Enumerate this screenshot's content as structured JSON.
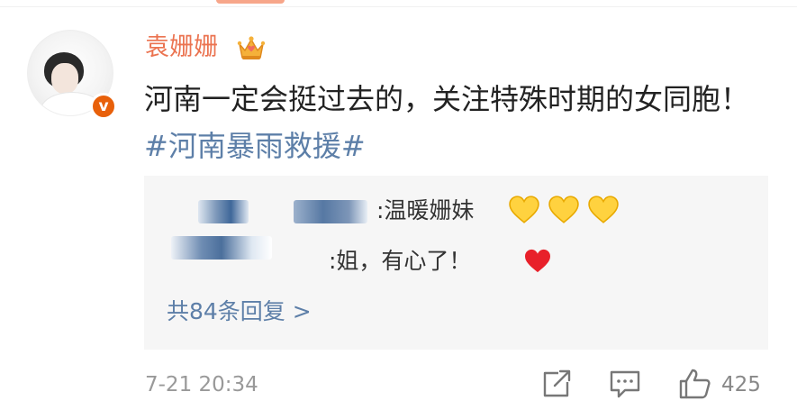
{
  "comment": {
    "username": "袁姗姗",
    "post_text": "河南一定会挺过去的，关注特殊时期的女同胞！",
    "hashtag": "#河南暴雨救援#",
    "timestamp": "7-21 20:34",
    "like_count": "425"
  },
  "replies": [
    {
      "text": ":温暖姗妹",
      "emoji": [
        "yellow-heart",
        "yellow-heart",
        "yellow-heart"
      ]
    },
    {
      "text": ":姐，有心了！",
      "emoji": [
        "red-heart"
      ]
    }
  ],
  "replies_more_label": "共84条回复 >",
  "colors": {
    "username": "#eb7350",
    "link": "#5d7fa8",
    "verified_badge": "#e8600a",
    "reply_background": "#f6f6f6",
    "meta_text": "#999999"
  },
  "icons": {
    "repost": "repost-icon",
    "comment": "comment-icon",
    "like": "like-icon",
    "member": "crown-icon",
    "verified": "verified-badge-icon"
  }
}
